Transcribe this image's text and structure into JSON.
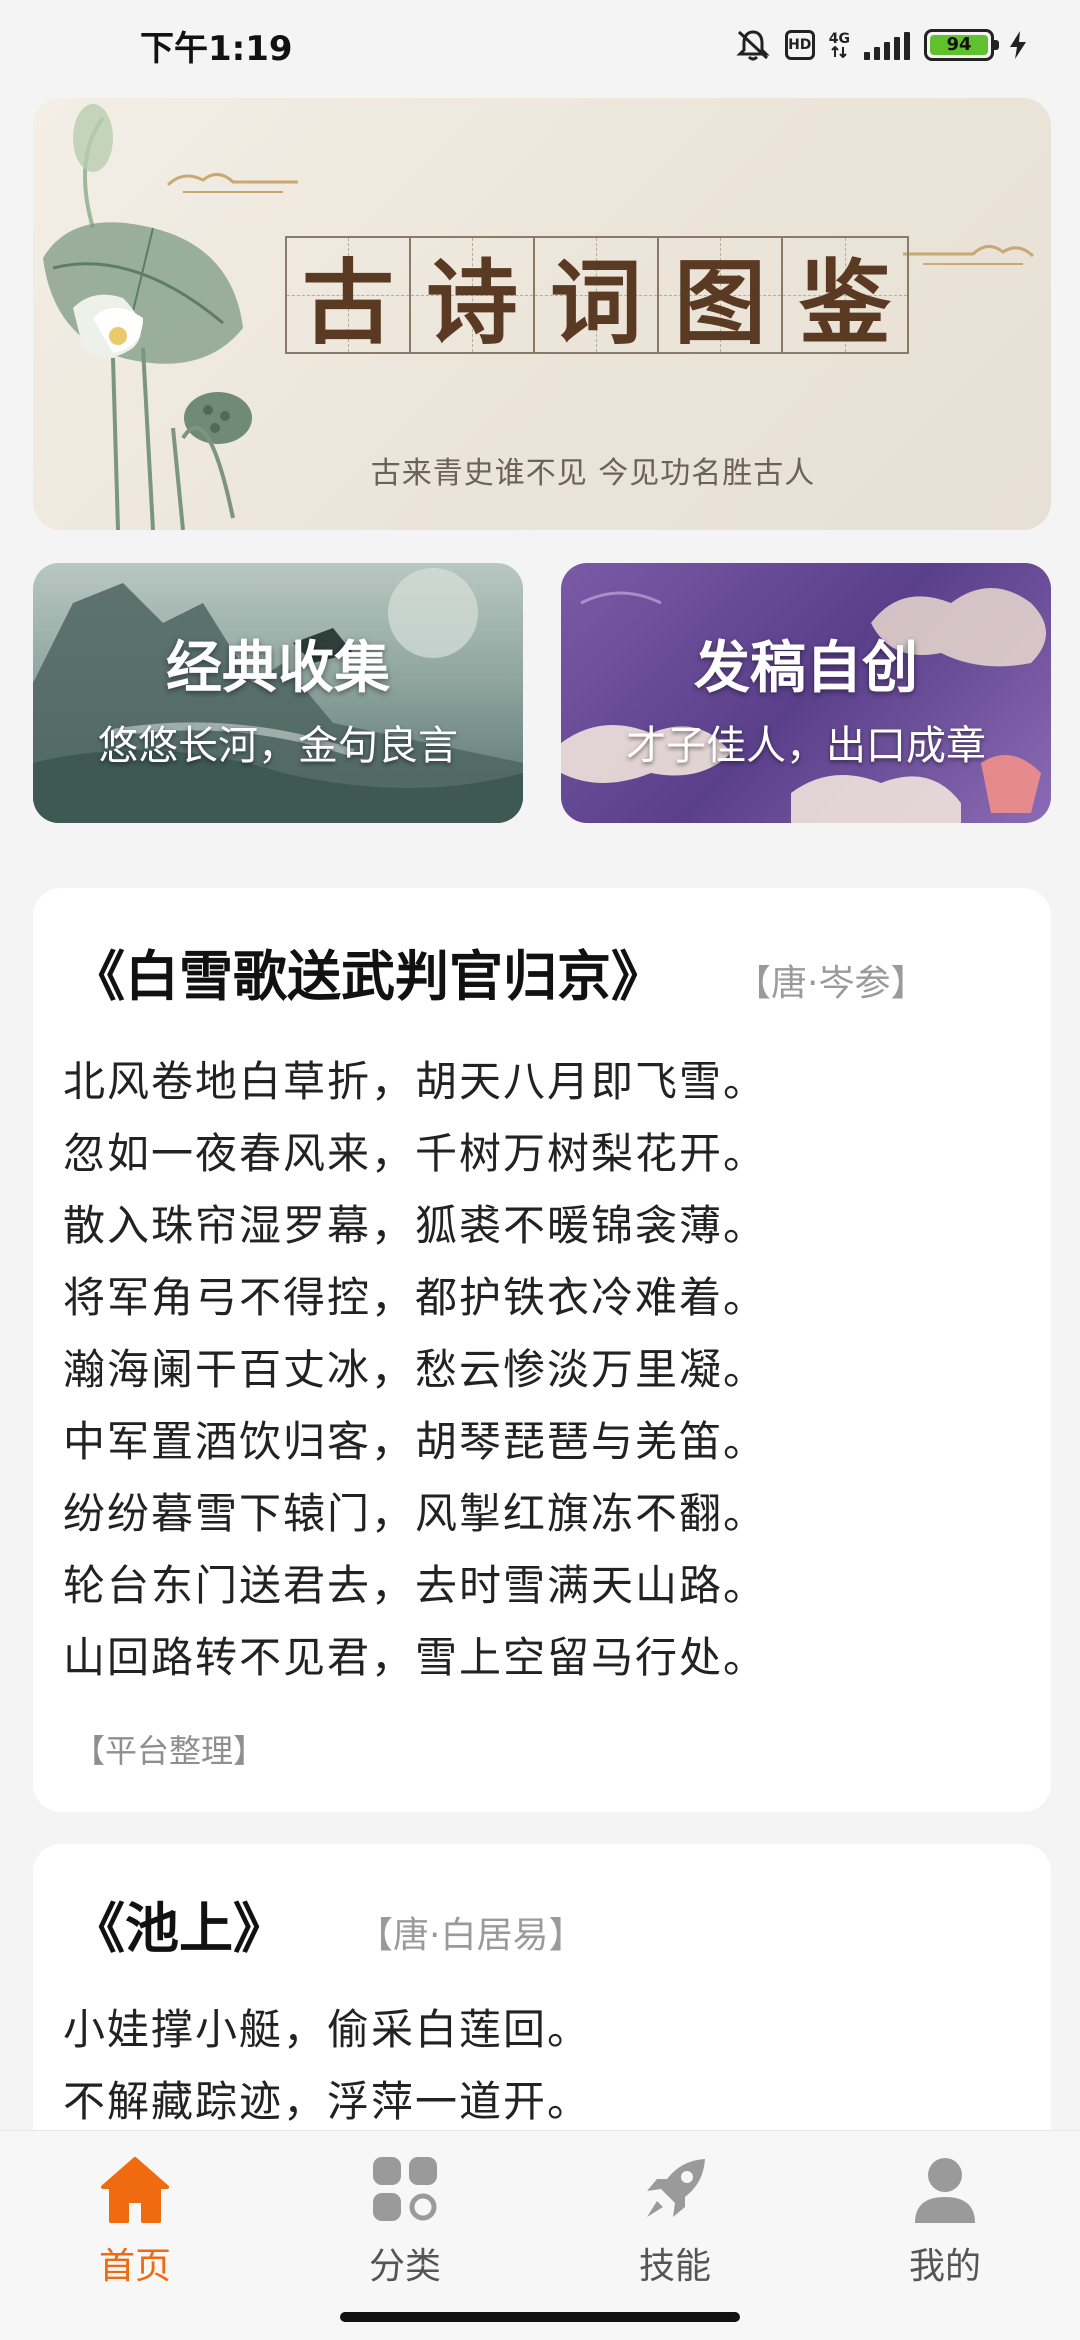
{
  "status_bar": {
    "time": "下午1:19",
    "hd": "HD",
    "network": "4G",
    "battery": "94",
    "battery_level": 0.94
  },
  "banner": {
    "title_chars": [
      "古",
      "诗",
      "词",
      "图",
      "鉴"
    ],
    "subtitle": "古来青史谁不见 今见功名胜古人",
    "active_page": 1,
    "page_count": 1
  },
  "features": [
    {
      "title": "经典收集",
      "subtitle": "悠悠长河，金句良言"
    },
    {
      "title": "发稿自创",
      "subtitle": "才子佳人，出口成章"
    }
  ],
  "poems": [
    {
      "title": "《白雪歌送武判官归京》",
      "author": "【唐·岑参】",
      "lines": [
        "北风卷地白草折，胡天八月即飞雪。",
        "忽如一夜春风来，千树万树梨花开。",
        "散入珠帘湿罗幕，狐裘不暖锦衾薄。",
        "将军角弓不得控，都护铁衣冷难着。",
        "瀚海阑干百丈冰，愁云惨淡万里凝。",
        "中军置酒饮归客，胡琴琵琶与羌笛。",
        "纷纷暮雪下辕门，风掣红旗冻不翻。",
        "轮台东门送君去，去时雪满天山路。",
        "山回路转不见君，雪上空留马行处。"
      ],
      "source": "【平台整理】"
    },
    {
      "title": "《池上》",
      "author": "【唐·白居易】",
      "lines": [
        "小娃撑小艇，偷采白莲回。",
        "不解藏踪迹，浮萍一道开。"
      ]
    }
  ],
  "bottom_nav": [
    {
      "label": "首页",
      "icon": "home-icon",
      "active": true
    },
    {
      "label": "分类",
      "icon": "category-icon",
      "active": false
    },
    {
      "label": "技能",
      "icon": "rocket-icon",
      "active": false
    },
    {
      "label": "我的",
      "icon": "user-icon",
      "active": false
    }
  ],
  "colors": {
    "accent": "#f06a0f",
    "inactive_icon": "#9a9a9a",
    "title_brown": "#5a3a22"
  }
}
